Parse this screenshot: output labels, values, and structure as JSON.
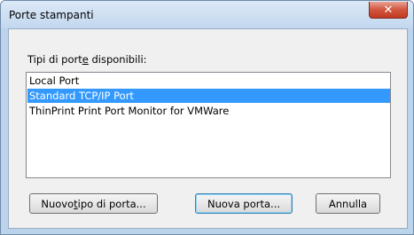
{
  "window": {
    "title": "Porte stampanti"
  },
  "icons": {
    "close": "close-icon"
  },
  "prompt": {
    "before": "Tipi di port",
    "mnemonic": "e",
    "after": " disponibili:"
  },
  "ports": [
    {
      "label": "Local Port",
      "selected": false
    },
    {
      "label": "Standard TCP/IP Port",
      "selected": true
    },
    {
      "label": "ThinPrint Print Port Monitor for VMWare",
      "selected": false
    }
  ],
  "buttons": {
    "new_type": {
      "before": "Nuovo ",
      "mnemonic": "t",
      "after": "ipo di porta..."
    },
    "new_port": "Nuova porta...",
    "cancel": "Annulla"
  },
  "colors": {
    "selection": "#3399ff",
    "close_button": "#c9452f"
  }
}
